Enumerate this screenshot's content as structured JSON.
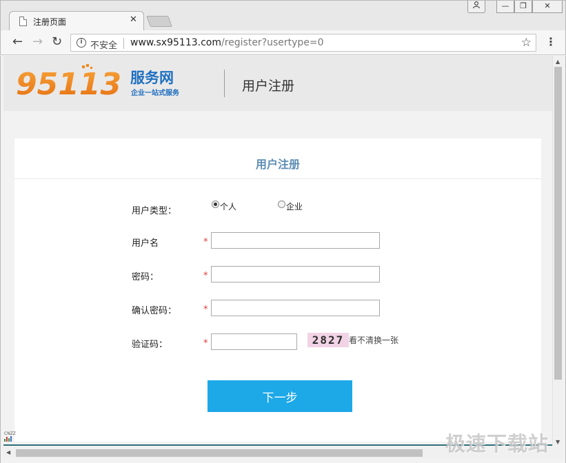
{
  "browser": {
    "tab_title": "注册页面",
    "tab_close": "✕",
    "security_label": "不安全",
    "url_host": "www.sx95113.com",
    "url_path": "/register?usertype=0",
    "icons": {
      "back": "arrow-left-icon",
      "forward": "arrow-right-icon",
      "reload": "reload-icon",
      "info": "info-icon",
      "star": "star-icon",
      "menu": "kebab-menu-icon"
    }
  },
  "window": {
    "minimize": "—",
    "restore": "❐",
    "close": "✕"
  },
  "header": {
    "logo_number": "95113",
    "logo_brand": "服务网",
    "logo_tagline": "企业一站式服务",
    "title": "用户注册"
  },
  "form": {
    "title": "用户注册",
    "user_type_label": "用户类型：",
    "user_type_options": [
      {
        "label": "个人",
        "checked": true
      },
      {
        "label": "企业",
        "checked": false
      }
    ],
    "username_label": "用户名",
    "password_label": "密码：",
    "confirm_password_label": "确认密码：",
    "captcha_label": "验证码：",
    "required_mark": "*",
    "captcha_code": "2827",
    "captcha_refresh": "看不清换一张",
    "next_button": "下一步"
  },
  "status": {
    "cnzz_label": "CNZZ"
  },
  "watermark": "极速下载站",
  "colors": {
    "accent_blue": "#1da8e8",
    "title_blue": "#5d8db4",
    "required_red": "#e23b3b",
    "captcha_bg": "#f2d3e6",
    "logo_orange": "#f08a1c",
    "logo_brand_blue": "#1f6fc0"
  }
}
